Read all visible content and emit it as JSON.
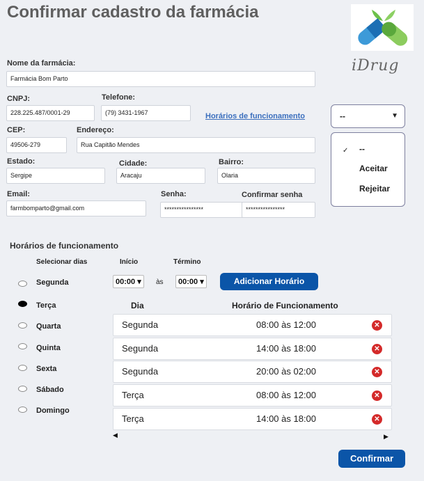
{
  "header": {
    "title": "Confirmar cadastro da farmácia",
    "brand": "iDrug"
  },
  "form": {
    "nome_label": "Nome da farmácia:",
    "nome_value": "Farmácia Bom Parto",
    "cnpj_label": "CNPJ:",
    "cnpj_value": "228.225.487/0001-29",
    "telefone_label": "Telefone:",
    "telefone_value": "(79) 3431-1967",
    "horarios_link": "Horários de funcionamento",
    "cep_label": "CEP:",
    "cep_value": "49506-279",
    "endereco_label": "Endereço:",
    "endereco_value": "Rua Capitão Mendes",
    "estado_label": "Estado:",
    "estado_value": "Sergipe",
    "cidade_label": "Cidade:",
    "cidade_value": "Aracaju",
    "bairro_label": "Bairro:",
    "bairro_value": "Olaria",
    "email_label": "Email:",
    "email_value": "farmbomparto@gmail.com",
    "senha_label": "Senha:",
    "senha_value": "****************",
    "confirmar_senha_label": "Confirmar senha",
    "confirmar_senha_value": "****************"
  },
  "status_select": {
    "selected": "--",
    "options": [
      "--",
      "Aceitar",
      "Rejeitar"
    ],
    "check_icon": "check-icon"
  },
  "schedule": {
    "section_title": "Horários de funcionamento",
    "select_days_label": "Selecionar dias",
    "start_label": "Início",
    "end_label": "Término",
    "days": [
      "Segunda",
      "Terça",
      "Quarta",
      "Quinta",
      "Sexta",
      "Sábado",
      "Domingo"
    ],
    "selected_day": "Terça",
    "start_value": "00:00 ▾",
    "between": "às",
    "end_value": "00:00 ▾",
    "add_button": "Adicionar Horário",
    "table_headers": {
      "day": "Dia",
      "hours": "Horário de Funcionamento"
    },
    "rows": [
      {
        "day": "Segunda",
        "hours": "08:00 às 12:00"
      },
      {
        "day": "Segunda",
        "hours": "14:00 às 18:00"
      },
      {
        "day": "Segunda",
        "hours": "20:00 às 02:00"
      },
      {
        "day": "Terça",
        "hours": "08:00 às 12:00"
      },
      {
        "day": "Terça",
        "hours": "14:00 às 18:00"
      }
    ]
  },
  "footer": {
    "confirm_button": "Confirmar"
  },
  "colors": {
    "primary": "#0b55a8",
    "delete": "#d42a2a",
    "link": "#3a6ebd",
    "background": "#eef0f4"
  }
}
